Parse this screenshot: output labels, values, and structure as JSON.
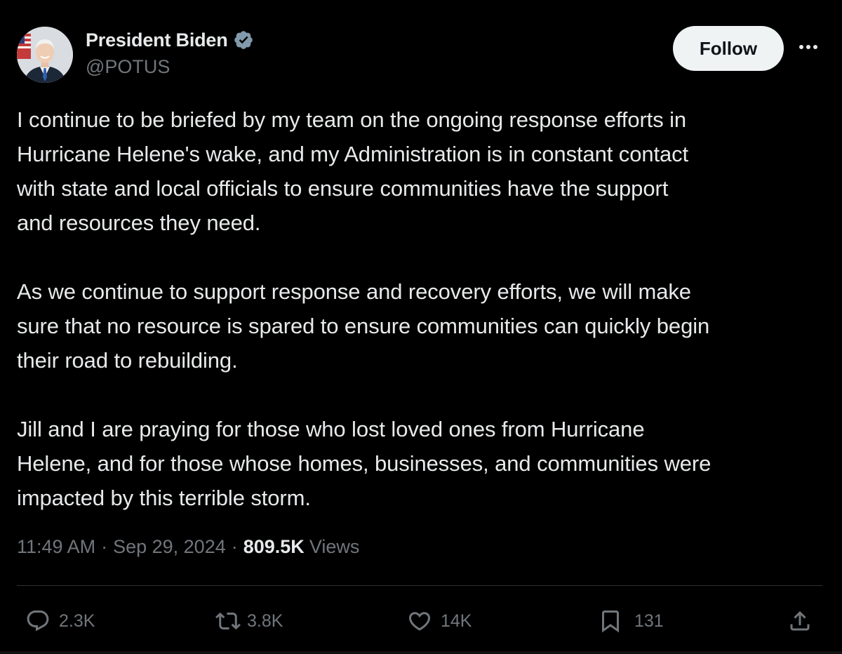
{
  "author": {
    "display_name": "President Biden",
    "handle": "@POTUS",
    "verified": true
  },
  "header": {
    "follow_label": "Follow",
    "more_label": "···"
  },
  "tweet": {
    "paragraphs": [
      "I continue to be briefed by my team on the ongoing response efforts in\nHurricane Helene's wake, and my Administration is in constant contact\nwith state and local officials to ensure communities have the support\nand resources they need.",
      "As we continue to support response and recovery efforts, we will make\nsure that no resource is spared to ensure communities can quickly begin\ntheir road to rebuilding.",
      "Jill and I are praying for those who lost loved ones from Hurricane\nHelene, and for those whose homes, businesses, and communities were\nimpacted by this terrible storm."
    ]
  },
  "meta": {
    "time": "11:49 AM",
    "separator": "·",
    "date": "Sep 29, 2024",
    "views_count": "809.5K",
    "views_label": "Views"
  },
  "actions": {
    "replies": "2.3K",
    "reposts": "3.8K",
    "likes": "14K",
    "bookmarks": "131"
  },
  "icons": {
    "verified": "verified-badge-icon",
    "reply": "reply-icon",
    "repost": "repost-icon",
    "like": "heart-icon",
    "bookmark": "bookmark-icon",
    "share": "share-icon",
    "more": "more-icon"
  },
  "colors": {
    "background": "#000000",
    "text_primary": "#e7e9ea",
    "text_secondary": "#71767b",
    "follow_button_bg": "#eff3f4",
    "follow_button_text": "#0f1419",
    "divider": "#2f3336"
  }
}
